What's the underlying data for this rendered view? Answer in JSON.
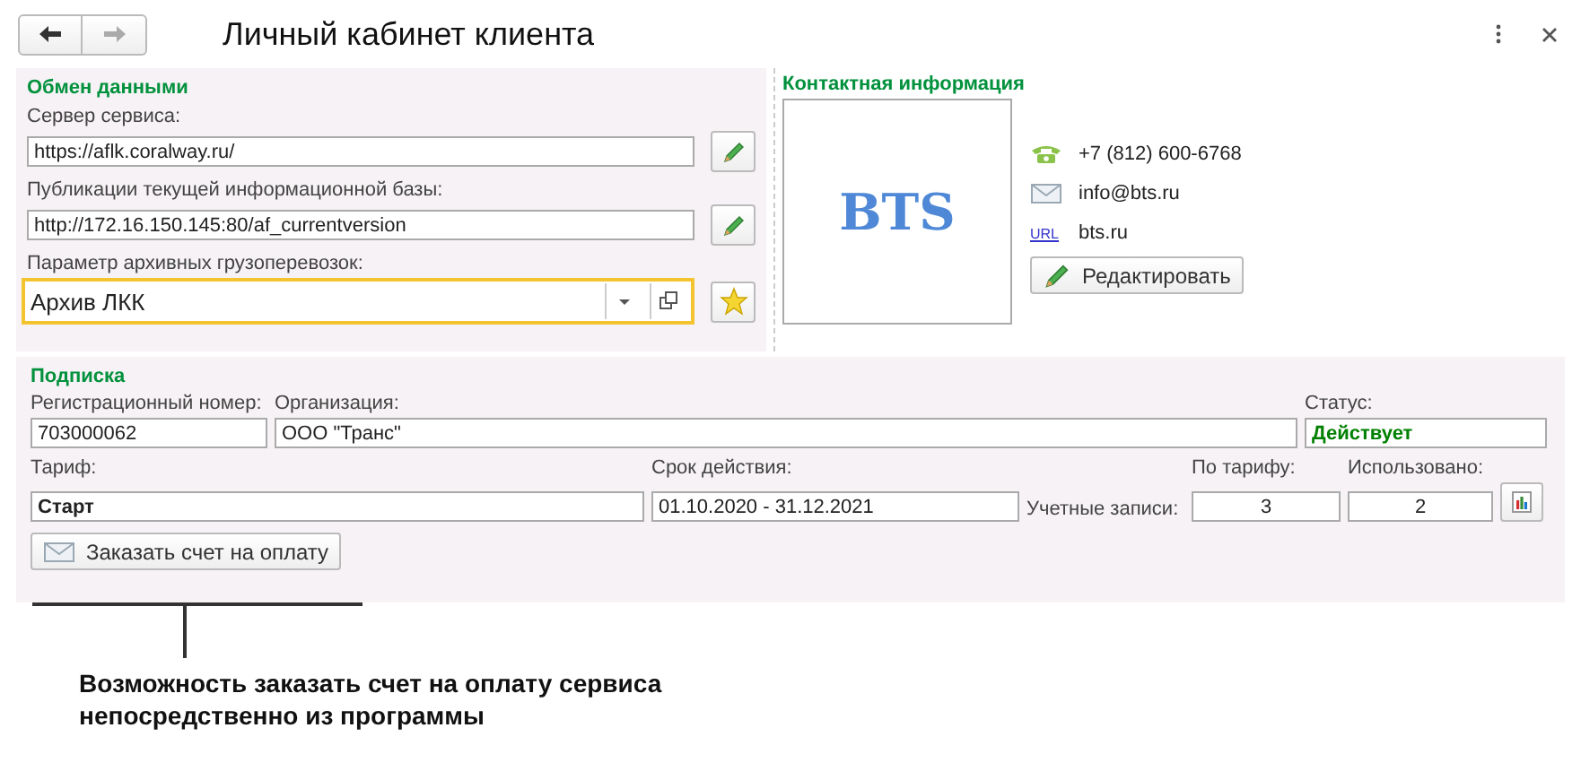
{
  "window": {
    "title": "Личный кабинет клиента",
    "nav": {
      "back_disabled": false,
      "forward_disabled": true
    }
  },
  "data_exchange": {
    "title": "Обмен данными",
    "fields": [
      {
        "label": "Сервер сервиса:",
        "value": "https://aflk.coralway.ru/",
        "kind": "edit"
      },
      {
        "label": "Публикации текущей информационной базы:",
        "value": "http://172.16.150.145:80/af_currentversion",
        "kind": "edit"
      },
      {
        "label": "Параметр архивных грузоперевозок:",
        "value": "Архив ЛКК",
        "kind": "combo",
        "focused": true
      }
    ]
  },
  "contact": {
    "title": "Контактная информация",
    "logo_text": "BTS",
    "items": [
      {
        "kind": "phone",
        "text": "+7 (812) 600-6768"
      },
      {
        "kind": "email",
        "text": "info@bts.ru"
      },
      {
        "kind": "url",
        "icon_text": "URL",
        "text": "bts.ru"
      }
    ],
    "edit_button": "Редактировать"
  },
  "subscription": {
    "title": "Подписка",
    "reg_number": {
      "label": "Регистрационный номер:",
      "value": "703000062"
    },
    "organization": {
      "label": "Организация:",
      "value": "ООО \"Транс\""
    },
    "status": {
      "label": "Статус:",
      "value": "Действует"
    },
    "tariff": {
      "label": "Тариф:",
      "value": "Старт"
    },
    "period": {
      "label": "Срок действия:",
      "value": "01.10.2020 - 31.12.2021"
    },
    "accounts": {
      "label": "Учетные записи:",
      "by_tariff_label": "По тарифу:",
      "by_tariff": "3",
      "used_label": "Использовано:",
      "used": "2"
    },
    "order_button": "Заказать счет на оплату"
  },
  "callout": "Возможность заказать счет на оплату сервиса непосредственно из программы"
}
